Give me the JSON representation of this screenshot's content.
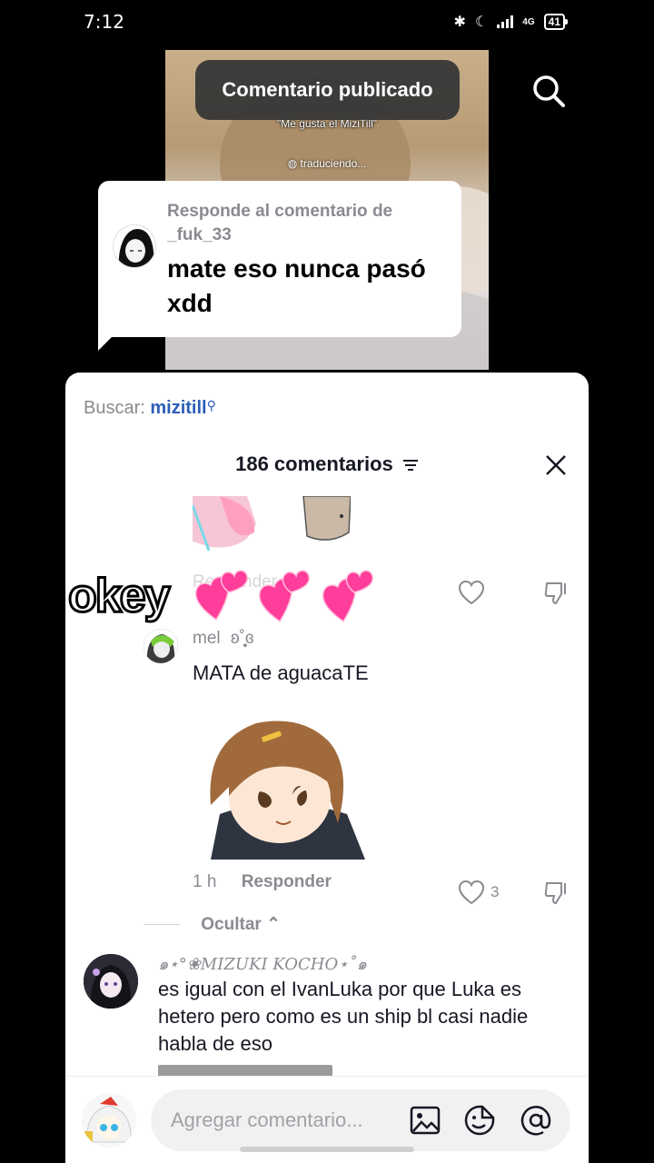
{
  "status_bar": {
    "time": "7:12",
    "network": "4G",
    "battery": "41"
  },
  "video": {
    "caption": "\"Me gusta el MiziTill\"",
    "translating": "traduciendo..."
  },
  "toast": {
    "text": "Comentario publicado"
  },
  "reply_card": {
    "heading": "Responde al comentario de _fuk_33",
    "text": "mate eso nunca pasó xdd"
  },
  "sheet": {
    "search_label": "Buscar:",
    "search_term": "mizitill",
    "title": "186 comentarios"
  },
  "comments": [
    {
      "overlay_text": "okey",
      "reply_label": "Responder"
    },
    {
      "username": "mel",
      "username_deco": "ʚ˚̩̥̩̥̩̥ɞ",
      "text": "MATA de aguacaTE",
      "time": "1 h",
      "reply_label": "Responder",
      "likes": "3"
    },
    {
      "username": "๑⋆°❀MIZUKI KOCHO⋆˚๑",
      "text": "es igual con el IvanLuka por que Luka es hetero pero como es un ship bl casi nadie habla de eso"
    }
  ],
  "hide_label": "Ocultar",
  "input": {
    "placeholder": "Agregar comentario..."
  },
  "colors": {
    "accent_link": "#2b5db8",
    "secondary_text": "#8a8b91",
    "heart_pink": "#ff3d9a"
  }
}
